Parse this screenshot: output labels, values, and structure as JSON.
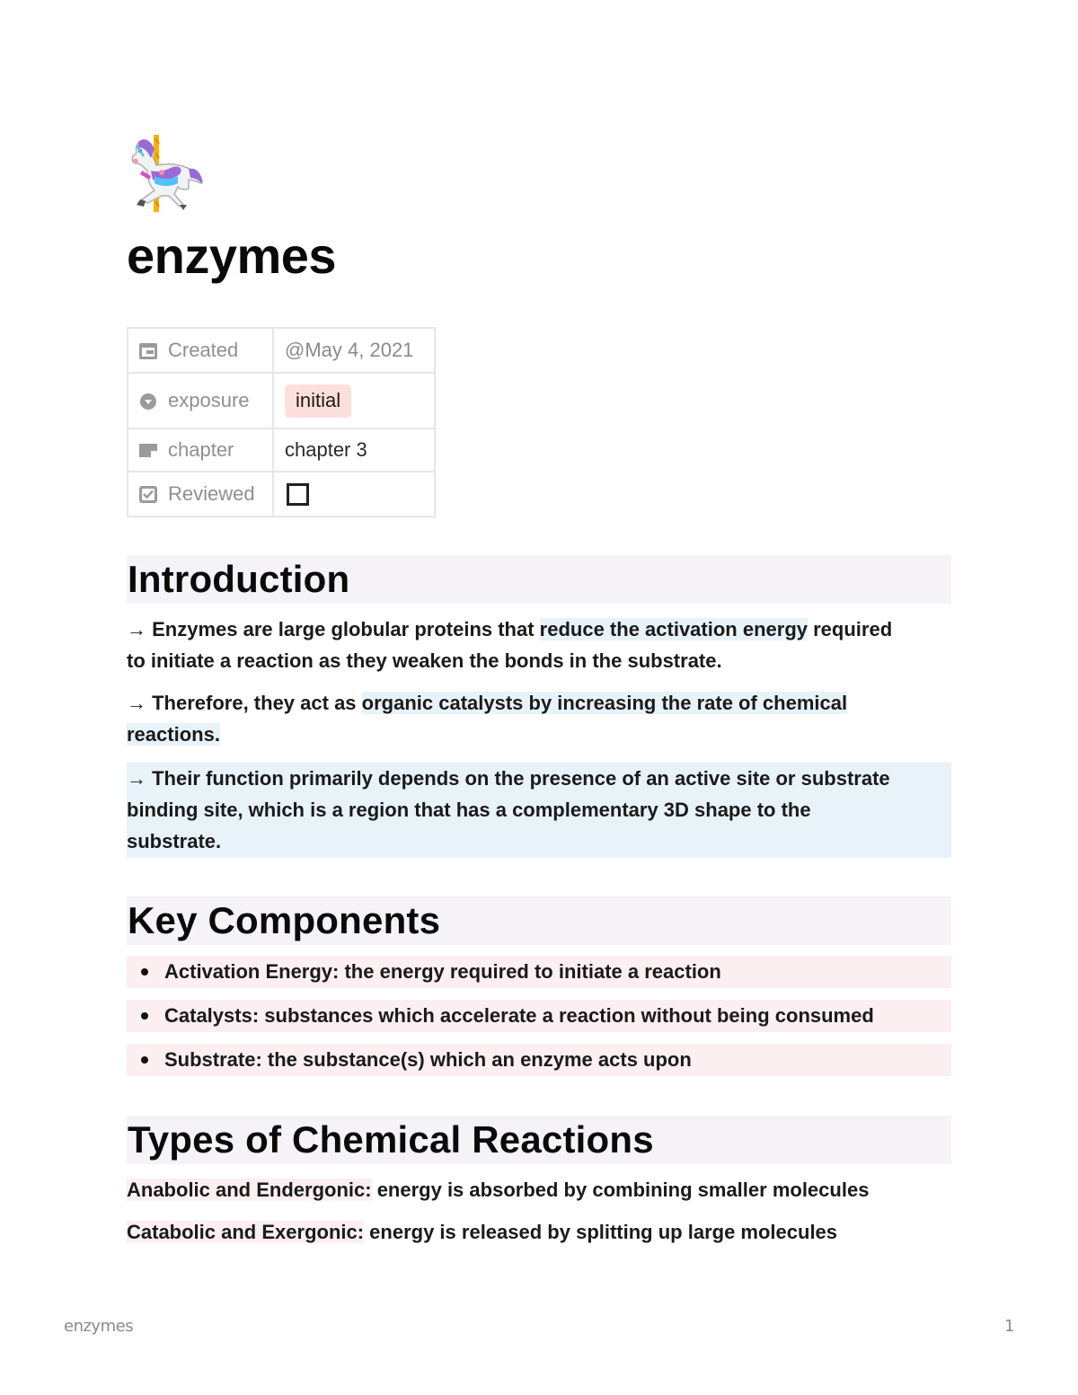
{
  "page": {
    "icon": "carousel-horse-emoji",
    "title": "enzymes"
  },
  "properties": [
    {
      "icon": "calendar-icon",
      "label": "Created",
      "value": "@May 4, 2021",
      "type": "date"
    },
    {
      "icon": "select-icon",
      "label": "exposure",
      "value": "initial",
      "type": "tag",
      "tag_color": "#fde0dd"
    },
    {
      "icon": "text-icon",
      "label": "chapter",
      "value": "chapter 3",
      "type": "text"
    },
    {
      "icon": "checkbox-icon",
      "label": "Reviewed",
      "value": false,
      "type": "checkbox"
    }
  ],
  "sections": {
    "introduction": {
      "heading": "Introduction",
      "p1": {
        "prefix": "→ Enzymes are large globular proteins that ",
        "highlight": "reduce the activation energy",
        "suffix_line1": " required",
        "line2": "to initiate a reaction as they weaken the bonds in the substrate."
      },
      "p2": {
        "prefix": "→ Therefore, they act as ",
        "highlight_line1": "organic catalysts by increasing the rate of chemical ",
        "highlight_line2": "reactions. "
      },
      "p3": {
        "line1": "→ Their function primarily depends on the presence of an active site or substrate",
        "line2": "binding site, which is a region that has a complementary 3D shape to the",
        "line3": "substrate."
      }
    },
    "key_components": {
      "heading": "Key Components",
      "items": [
        "Activation Energy: the energy required to initiate a reaction",
        "Catalysts: substances which accelerate a reaction without being consumed",
        "Substrate: the substance(s) which an enzyme acts upon"
      ]
    },
    "reactions": {
      "heading": "Types of Chemical Reactions",
      "rows": [
        {
          "term": "Anabolic and Endergonic:",
          "desc": " energy is absorbed by combining smaller molecules"
        },
        {
          "term": "Catabolic and Exergonic:",
          "desc": " energy is released by splitting up large molecules"
        }
      ]
    }
  },
  "colors": {
    "heading_bg": "#f5f3f8",
    "blue_highlight": "#e8f2f9",
    "pink_highlight": "#fbeff2",
    "tag_bg": "#fde0dd"
  },
  "footer": {
    "title": "enzymes",
    "page_number": "1"
  }
}
